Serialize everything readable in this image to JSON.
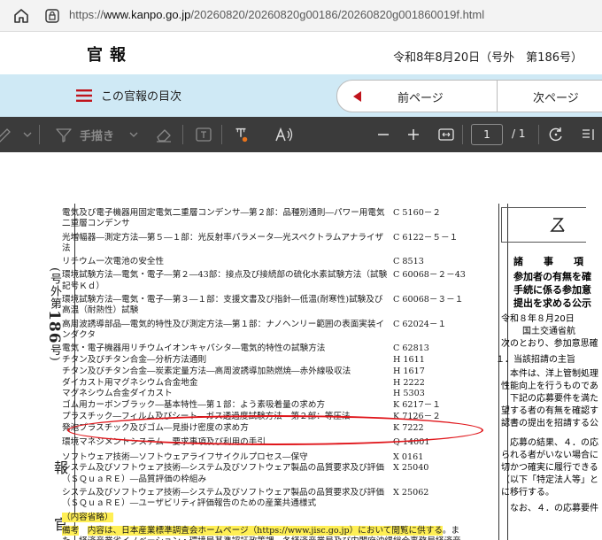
{
  "browser": {
    "url_prefix": "https://",
    "url_host": "www.kanpo.go.jp",
    "url_path": "/20260820/20260820g00186/20260820g001860019f.html"
  },
  "header": {
    "logo": "官報",
    "issue_info": "令和8年8月20日（号外　第186号）"
  },
  "nav": {
    "toc_label": "この官報の目次",
    "prev_label": "前ページ",
    "next_label": "次ページ"
  },
  "pdf_toolbar": {
    "draw_label": "手描き",
    "page_current": "1",
    "page_total": "/ 1"
  },
  "document": {
    "side_issue_prefix": "(号外第",
    "side_issue_number": "186",
    "side_issue_suffix": "号)",
    "side_kanpo_1": "報",
    "side_kanpo_2": "官",
    "standards": [
      {
        "title": "電気及び電子機器用固定電気二重層コンデンサ―第２部：品種別通則―パワー用電気二重層コンデンサ",
        "code": "C 5160－２"
      },
      {
        "title": "光増幅器―測定方法―第５―１部：光反射率パラメータ―光スペクトラムアナライザ法",
        "code": "C 6122－５－１"
      },
      {
        "title": "リチウム一次電池の安全性",
        "code": "C 8513"
      },
      {
        "title": "環境試験方法―電気・電子―第２―43部：接点及び接続部の硫化水素試験方法（試験記号Ｋｄ）",
        "code": "C 60068－２－43"
      },
      {
        "title": "環境試験方法―電気・電子―第３―１部：支援文書及び指針―低温(耐寒性)試験及び高温（耐熱性）試験",
        "code": "C 60068－３－１"
      },
      {
        "title": "高周波誘導部品―電気的特性及び測定方法―第１部：ナノヘンリー範囲の表面実装インダクタ",
        "code": "C 62024－１"
      },
      {
        "title": "電気・電子機器用リチウムイオンキャパシタ―電気的特性の試験方法",
        "code": "C 62813"
      },
      {
        "title": "チタン及びチタン合金―分析方法通則",
        "code": "H 1611"
      },
      {
        "title": "チタン及びチタン合金―炭素定量方法―高周波誘導加熱燃焼―赤外線吸収法",
        "code": "H 1617"
      },
      {
        "title": "ダイカスト用マグネシウム合金地金",
        "code": "H 2222"
      },
      {
        "title": "マグネシウム合金ダイカスト",
        "code": "H 5303"
      },
      {
        "title": "ゴム用カーボンブラック―基本特性―第１部：よう素吸着量の求め方",
        "code": "K 6217－１"
      },
      {
        "title": "プラスチック―フィルム及びシート―ガス透過度試験方法―第２部：等圧法",
        "code": "K 7126－２"
      },
      {
        "title": "発泡プラスチック及びゴム―見掛け密度の求め方",
        "code": "K 7222"
      },
      {
        "title": "環境マネジメントシステム―要求事項及び利用の手引",
        "code": "Q 14001"
      },
      {
        "title": "ソフトウェア技術―ソフトウェアライフサイクルプロセス―保守",
        "code": "X 0161"
      },
      {
        "title": "システム及びソフトウェア技術―システム及びソフトウェア製品の品質要求及び評価（ＳＱｕａＲＥ）―品質評価の枠組み",
        "code": "X 25040"
      },
      {
        "title": "システム及びソフトウェア技術―システム及びソフトウェア製品の品質要求及び評価（ＳＱｕａＲＥ）―ユーザビリティ評価報告のための産業共通様式",
        "code": "X 25062"
      }
    ],
    "omission_note": "（内容省略）",
    "note_label": "備考",
    "note_text_1": "内容は、日本産業標準調査会ホームページ（https://www.jisc.go.jp）において閲覧に供する",
    "note_text_2": "。また、経済産業省イノベーション・環境局基準認証政策課、各経済産業局及び内閣府沖縄総合事務局経済産業部においても閲覧に供する。",
    "right": {
      "section_header": "諸　事　項",
      "title_1": "参加者の有無を確",
      "title_2": "手続に係る参加意",
      "title_3": "提出を求める公示",
      "date": "令和８年８月20日",
      "org": "国土交通省航",
      "lines": [
        "次のとおり、参加意思確",
        "１．当該招請の主旨",
        "　本件は、洋上管制処理",
        "性能向上を行うものであ",
        "　下記の応募要件を満た",
        "望する者の有無を確認す",
        "認書の提出を招請する公",
        "　応募の結果、４．の応",
        "られる者がいない場合に",
        "切かつ確実に履行できる",
        "（以下「特定法人等」と",
        "に移行する。",
        "　なお、４．の応募要件"
      ]
    }
  },
  "colors": {
    "nav_band": "#cfe9f5",
    "pdf_toolbar": "#3b3b3b",
    "prev_arrow": "#c0141c",
    "highlight_oval": "#e0161b",
    "marker": "#ffef55"
  }
}
